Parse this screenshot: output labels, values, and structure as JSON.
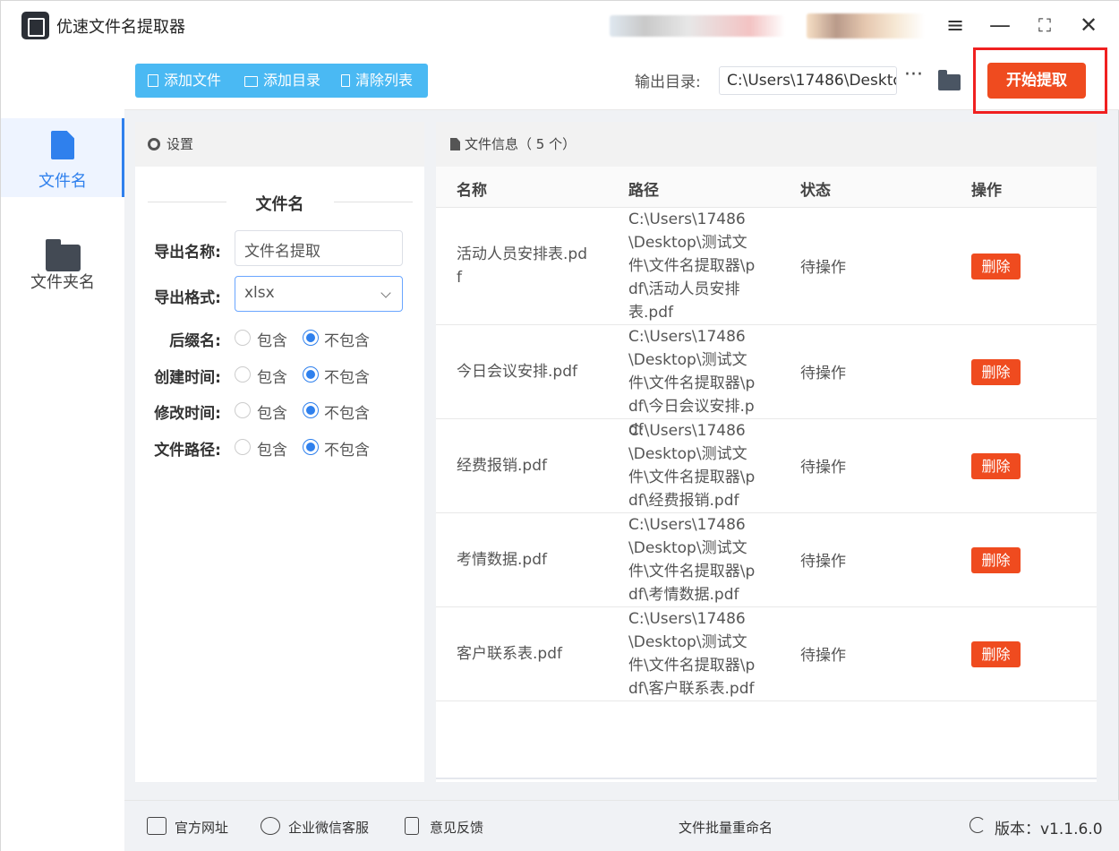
{
  "app": {
    "title": "优速文件名提取器"
  },
  "sidebar": {
    "items": [
      {
        "label": "文件名"
      },
      {
        "label": "文件夹名"
      }
    ]
  },
  "toolbar": {
    "add_file": "添加文件",
    "add_dir": "添加目录",
    "clear_list": "清除列表",
    "output_label": "输出目录:",
    "output_value": "C:\\Users\\17486\\Deskto",
    "more": "···",
    "start": "开始提取"
  },
  "settings": {
    "header": "设置",
    "section": "文件名",
    "export_name_label": "导出名称:",
    "export_name_value": "文件名提取",
    "export_format_label": "导出格式:",
    "export_format_value": "xlsx",
    "options": [
      {
        "label": "后缀名:",
        "include": "包含",
        "exclude": "不包含",
        "selected": "exclude"
      },
      {
        "label": "创建时间:",
        "include": "包含",
        "exclude": "不包含",
        "selected": "exclude"
      },
      {
        "label": "修改时间:",
        "include": "包含",
        "exclude": "不包含",
        "selected": "exclude"
      },
      {
        "label": "文件路径:",
        "include": "包含",
        "exclude": "不包含",
        "selected": "exclude"
      }
    ]
  },
  "fileinfo": {
    "header": "文件信息（ 5 个）",
    "columns": [
      "名称",
      "路径",
      "状态",
      "操作"
    ],
    "rows": [
      {
        "name": "活动人员安排表.pdf",
        "path": "C:\\Users\\17486\\Desktop\\测试文件\\文件名提取器\\pdf\\活动人员安排表.pdf",
        "status": "待操作",
        "action": "删除"
      },
      {
        "name": "今日会议安排.pdf",
        "path": "C:\\Users\\17486\\Desktop\\测试文件\\文件名提取器\\pdf\\今日会议安排.pdf",
        "status": "待操作",
        "action": "删除"
      },
      {
        "name": "经费报销.pdf",
        "path": "C:\\Users\\17486\\Desktop\\测试文件\\文件名提取器\\pdf\\经费报销.pdf",
        "status": "待操作",
        "action": "删除"
      },
      {
        "name": "考情数据.pdf",
        "path": "C:\\Users\\17486\\Desktop\\测试文件\\文件名提取器\\pdf\\考情数据.pdf",
        "status": "待操作",
        "action": "删除"
      },
      {
        "name": "客户联系表.pdf",
        "path": "C:\\Users\\17486\\Desktop\\测试文件\\文件名提取器\\pdf\\客户联系表.pdf",
        "status": "待操作",
        "action": "删除"
      }
    ]
  },
  "footer": {
    "website": "官方网址",
    "wechat": "企业微信客服",
    "feedback": "意见反馈",
    "rename": "文件批量重命名",
    "version": "版本：v1.1.6.0"
  },
  "colors": {
    "accent": "#2f80ed",
    "start": "#ef4b1f",
    "toolbar": "#4ab9f3",
    "highlight": "#f02020"
  }
}
